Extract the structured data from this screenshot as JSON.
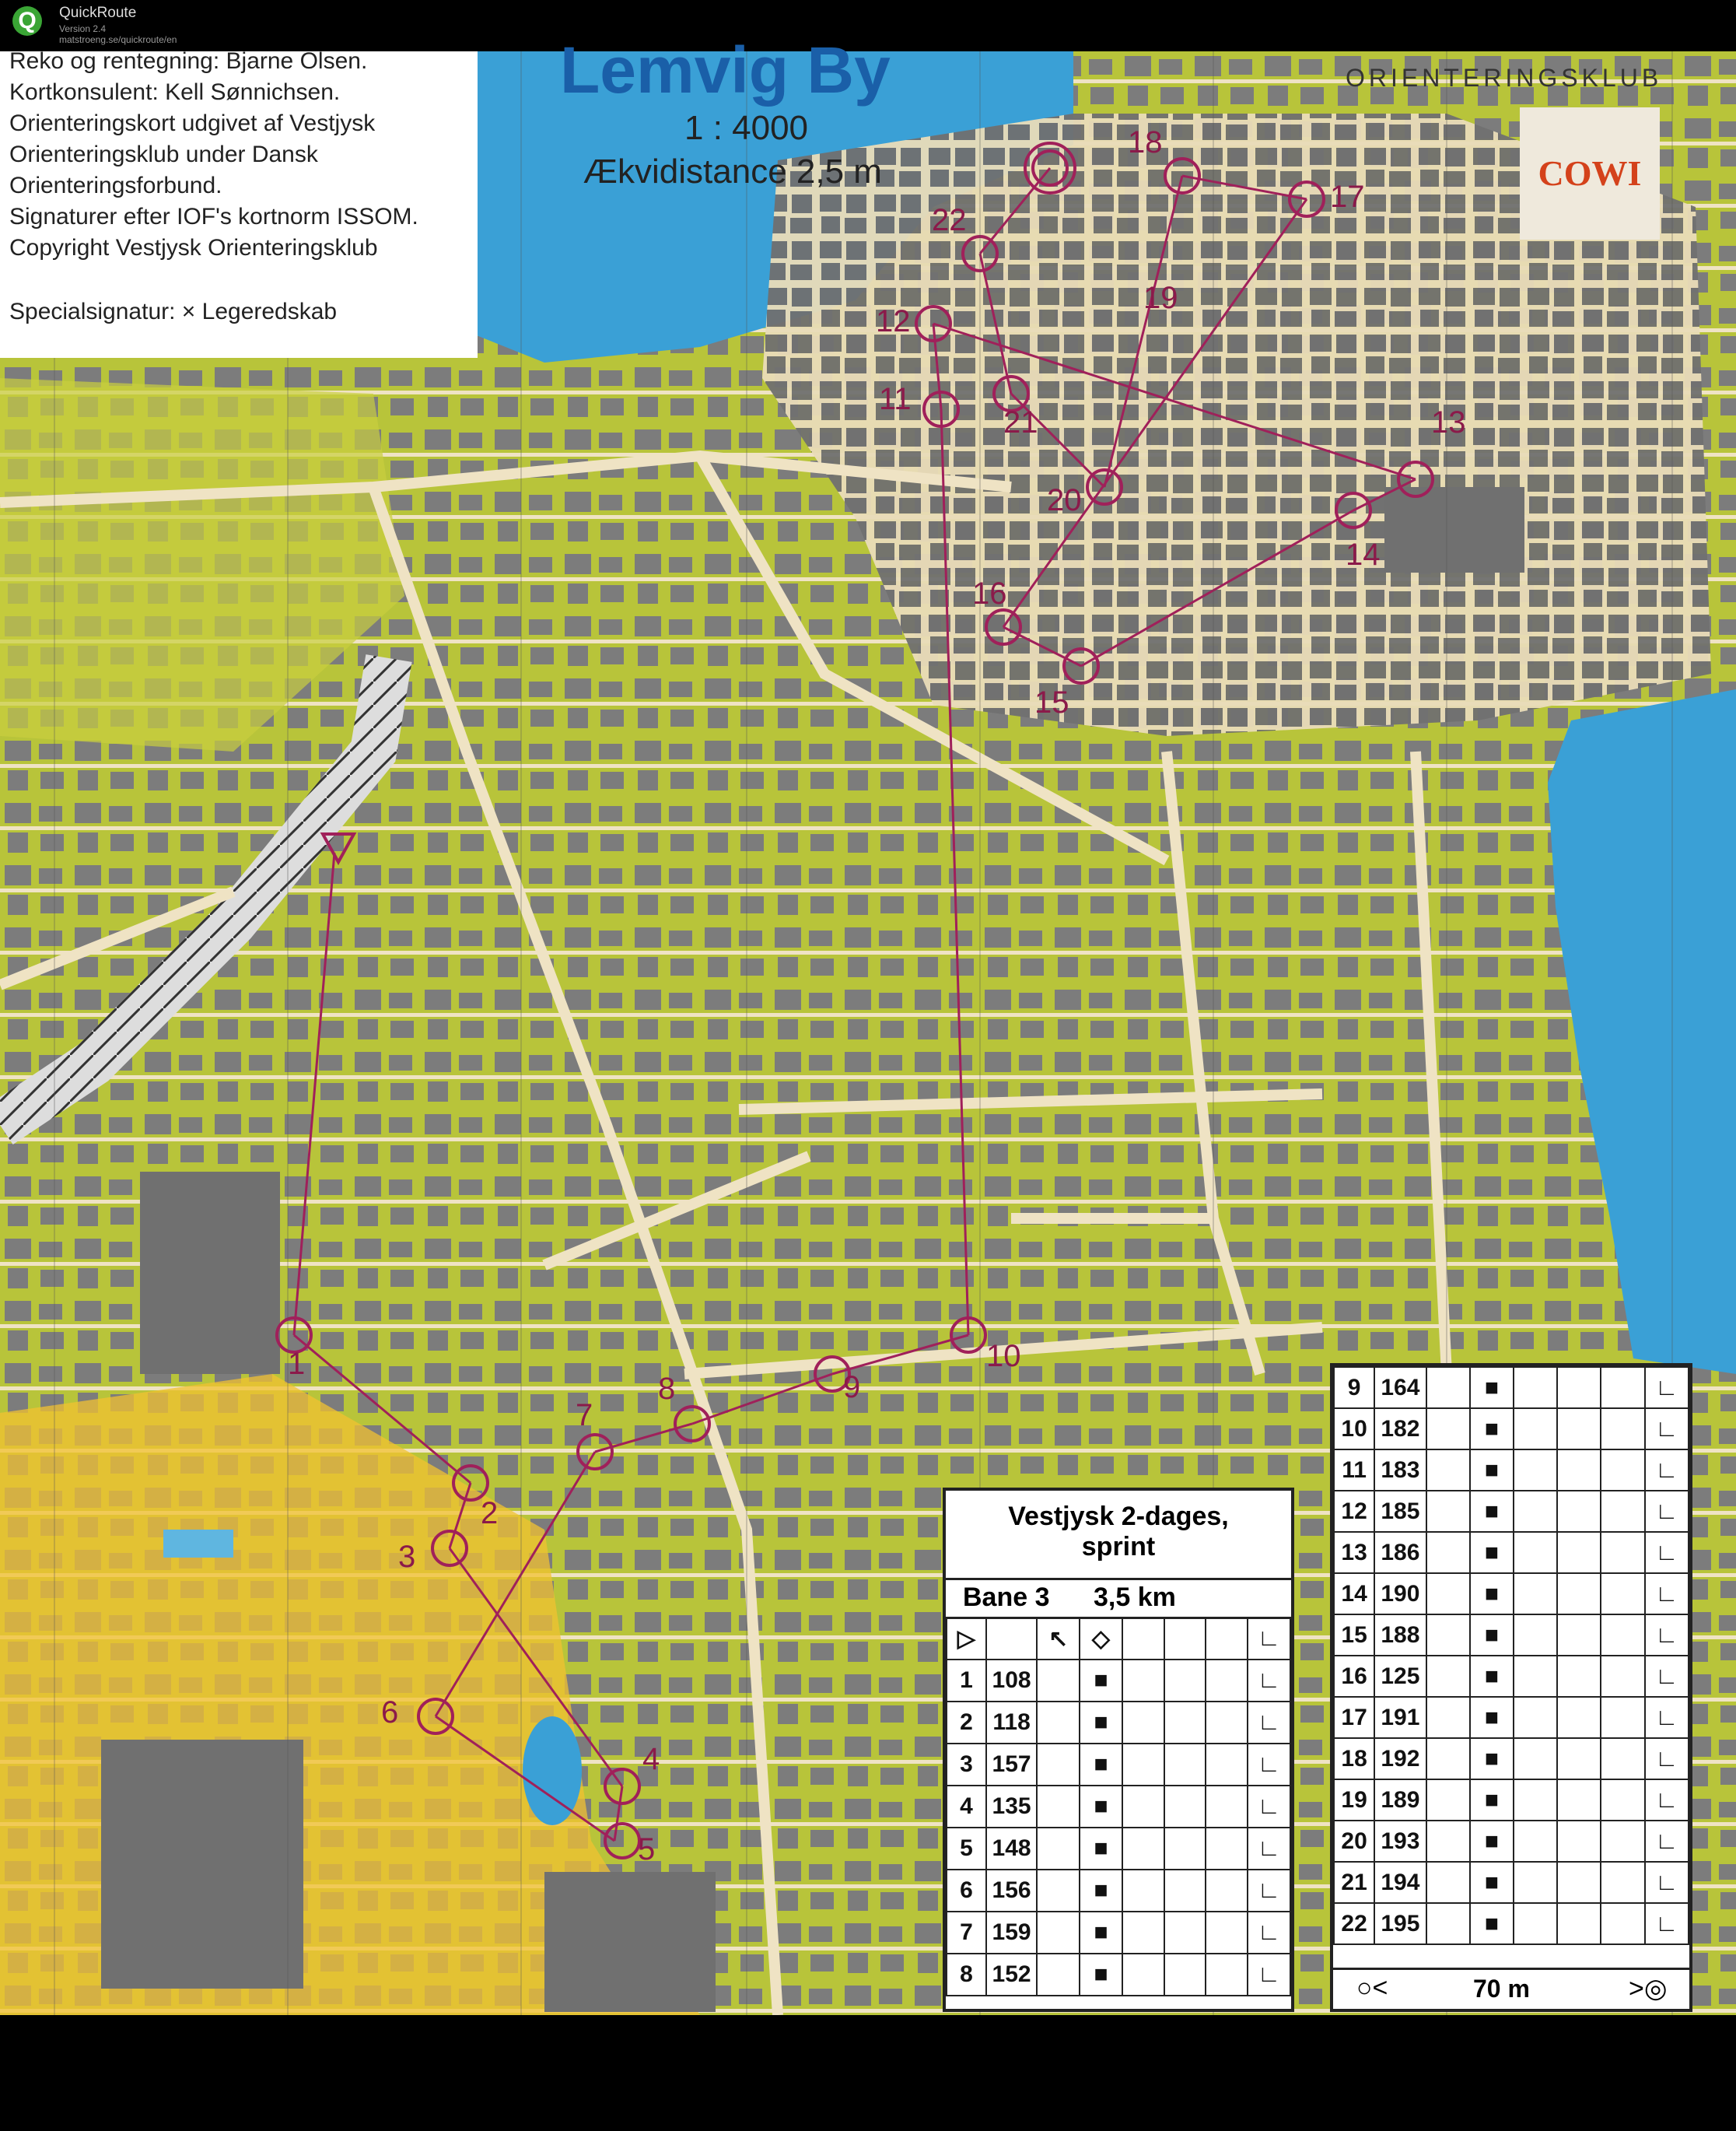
{
  "app": {
    "name": "QuickRoute",
    "version": "Version 2.4",
    "url": "matstroeng.se/quickroute/en"
  },
  "map": {
    "title": "Lemvig By",
    "scale": "1 : 4000",
    "equidistance": "Ækvidistance 2,5 m",
    "club_logo_text": "ORIENTERINGSKLUB",
    "sponsor": "COWI",
    "info_lines": [
      "Reko og rentegning: Bjarne Olsen.",
      "Kortkonsulent: Kell Sønnichsen.",
      "Orienteringskort udgivet af Vestjysk",
      "Orienteringsklub under Dansk",
      "Orienteringsforbund.",
      "Signaturer efter IOF's kortnorm ISSOM.",
      "Copyright Vestjysk Orienteringsklub"
    ],
    "special_symbol": "Specialsignatur:  × Legeredskab",
    "control_numbers": [
      "1",
      "2",
      "3",
      "4",
      "5",
      "6",
      "7",
      "8",
      "9",
      "10",
      "11",
      "12",
      "13",
      "14",
      "15",
      "16",
      "17",
      "18",
      "19",
      "20",
      "21",
      "22"
    ]
  },
  "course": {
    "event": "Vestjysk 2-dages, sprint",
    "event_line1": "Vestjysk 2-dages,",
    "event_line2": "sprint",
    "course_name": "Bane 3",
    "length": "3,5 km",
    "controls_left": [
      {
        "n": "1",
        "code": "108"
      },
      {
        "n": "2",
        "code": "118"
      },
      {
        "n": "3",
        "code": "157"
      },
      {
        "n": "4",
        "code": "135"
      },
      {
        "n": "5",
        "code": "148"
      },
      {
        "n": "6",
        "code": "156"
      },
      {
        "n": "7",
        "code": "159"
      },
      {
        "n": "8",
        "code": "152"
      }
    ],
    "controls_right": [
      {
        "n": "9",
        "code": "164"
      },
      {
        "n": "10",
        "code": "182"
      },
      {
        "n": "11",
        "code": "183"
      },
      {
        "n": "12",
        "code": "185"
      },
      {
        "n": "13",
        "code": "186"
      },
      {
        "n": "14",
        "code": "190"
      },
      {
        "n": "15",
        "code": "188"
      },
      {
        "n": "16",
        "code": "125"
      },
      {
        "n": "17",
        "code": "191"
      },
      {
        "n": "18",
        "code": "192"
      },
      {
        "n": "19",
        "code": "189"
      },
      {
        "n": "20",
        "code": "193"
      },
      {
        "n": "21",
        "code": "194"
      },
      {
        "n": "22",
        "code": "195"
      }
    ],
    "finish_distance": "70 m"
  }
}
